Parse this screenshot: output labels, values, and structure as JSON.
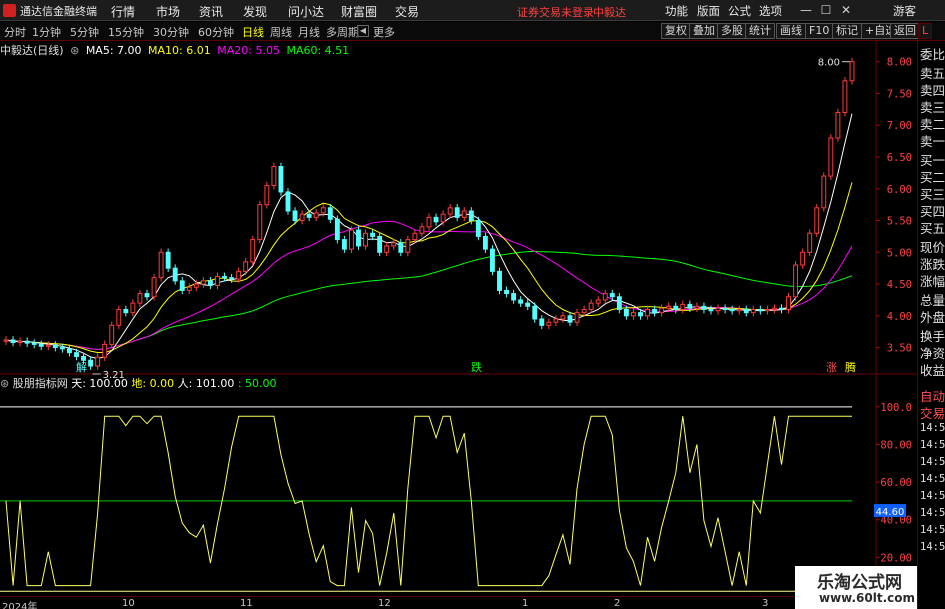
{
  "app": {
    "title": "通达信金融终端"
  },
  "menu": [
    "行情",
    "市场",
    "资讯",
    "发现",
    "问小达",
    "财富圈",
    "交易"
  ],
  "warning": "证券交易未登录",
  "stock_name_top": "中毅达",
  "right_menu": [
    "功能",
    "版面",
    "公式",
    "选项"
  ],
  "guest": "游客",
  "window_buttons": {
    "min": "—",
    "max": "☐",
    "close": "✕"
  },
  "toolbar": {
    "periods": [
      "分时",
      "1分钟",
      "5分钟",
      "15分钟",
      "30分钟",
      "60分钟",
      "日线",
      "周线",
      "月线",
      "多周期",
      "更多"
    ],
    "active_period": "日线",
    "scroll_icon": "◀",
    "buttons": [
      "复权",
      "叠加",
      "多股",
      "统计",
      "画线",
      "F10",
      "标记",
      "+自选",
      "返回"
    ]
  },
  "main_info": {
    "title": "中毅达(日线)",
    "ma5": "MA5: 7.00",
    "ma10": "MA10: 6.01",
    "ma20": "MA20: 5.05",
    "ma60": "MA60: 4.51"
  },
  "main_annotations": {
    "high_label": "8.00",
    "low_label": "3.21",
    "mark_jie": "解",
    "mark_die": "跌",
    "mark_zhang": "涨",
    "mark_teng": "腾"
  },
  "indicator_info": {
    "name": "股朋指标网",
    "tian": "天: 100.00",
    "di": "地: 0.00",
    "ren": "人: 101.00",
    "fifty": ": 50.00"
  },
  "right_panel": {
    "labels": [
      "委比",
      "卖五",
      "卖四",
      "卖三",
      "卖二",
      "卖一",
      "买一",
      "买二",
      "买三",
      "买四",
      "买五",
      "现价",
      "涨跌",
      "涨幅",
      "总量",
      "外盘",
      "换手",
      "净资",
      "收益",
      "自动",
      "交易"
    ],
    "time_labels": [
      "14:56",
      "14:56",
      "14:56",
      "14:56",
      "14:56",
      "14:56",
      "14:56",
      "14:56"
    ]
  },
  "dates": [
    "2024年",
    "10",
    "11",
    "12",
    "1",
    "2",
    "3"
  ],
  "watermark": {
    "line1": "乐淘公式网",
    "line2": "www.60lt.com"
  },
  "colors": {
    "up": "#ff3c3c",
    "down": "#54ffff",
    "ma5": "#ffffff",
    "ma10": "#ffff00",
    "ma20": "#ff00ff",
    "ma60": "#00ff00",
    "indicator_line": "#ffff60",
    "line50": "#00d000"
  },
  "chart_data": [
    {
      "type": "candlestick",
      "title": "中毅达(日线)",
      "x_range": [
        "2024-09",
        "2025-03"
      ],
      "ylim": [
        3.1,
        8.2
      ],
      "y_ticks": [
        3.5,
        4.0,
        4.5,
        5.0,
        5.5,
        6.0,
        6.5,
        7.0,
        7.5,
        8.0
      ],
      "y_tick_labels": [
        "3.50",
        "4.00",
        "4.50",
        "5.00",
        "5.50",
        "6.00",
        "6.50",
        "7.00",
        "7.50",
        "8.00"
      ],
      "candles_close": [
        3.62,
        3.58,
        3.6,
        3.57,
        3.55,
        3.52,
        3.54,
        3.5,
        3.48,
        3.42,
        3.36,
        3.3,
        3.21,
        3.35,
        3.55,
        3.85,
        4.1,
        4.05,
        4.2,
        4.35,
        4.3,
        4.6,
        5.0,
        4.75,
        4.55,
        4.4,
        4.45,
        4.5,
        4.55,
        4.48,
        4.62,
        4.6,
        4.58,
        4.7,
        4.85,
        5.2,
        5.75,
        6.05,
        6.35,
        5.95,
        5.65,
        5.5,
        5.6,
        5.55,
        5.62,
        5.7,
        5.52,
        5.2,
        5.05,
        5.35,
        5.1,
        5.3,
        5.25,
        5.0,
        5.1,
        5.15,
        5.0,
        5.2,
        5.3,
        5.4,
        5.55,
        5.48,
        5.6,
        5.7,
        5.55,
        5.65,
        5.5,
        5.25,
        5.05,
        4.7,
        4.4,
        4.35,
        4.25,
        4.2,
        4.15,
        3.95,
        3.85,
        3.9,
        3.95,
        4.0,
        3.9,
        4.05,
        4.1,
        4.2,
        4.25,
        4.35,
        4.3,
        4.1,
        4.0,
        4.05,
        4.0,
        4.1,
        4.05,
        4.12,
        4.15,
        4.1,
        4.18,
        4.12,
        4.15,
        4.1,
        4.08,
        4.12,
        4.1,
        4.08,
        4.1,
        4.05,
        4.1,
        4.08,
        4.1,
        4.12,
        4.1,
        4.3,
        4.8,
        5.0,
        5.3,
        5.7,
        6.2,
        6.8,
        7.2,
        7.7,
        8.0
      ],
      "series": [
        {
          "name": "MA5",
          "value": 7.0
        },
        {
          "name": "MA10",
          "value": 6.01
        },
        {
          "name": "MA20",
          "value": 5.05
        },
        {
          "name": "MA60",
          "value": 4.51
        }
      ],
      "high": 8.0,
      "low": 3.21
    },
    {
      "type": "line",
      "title": "股朋指标网",
      "ylim": [
        0,
        110
      ],
      "y_ticks": [
        20,
        40,
        60,
        80,
        100
      ],
      "y_tick_labels": [
        "20.00",
        "40.00",
        "60.00",
        "80.00",
        "100.0"
      ],
      "current_marker": "44.60",
      "current_value": 44.6,
      "hlines": [
        {
          "name": "天",
          "value": 100.0
        },
        {
          "name": "地",
          "value": 0.0
        },
        {
          "name": "人",
          "value": 101.0
        },
        {
          "name": "50",
          "value": 50.0
        }
      ]
    }
  ]
}
